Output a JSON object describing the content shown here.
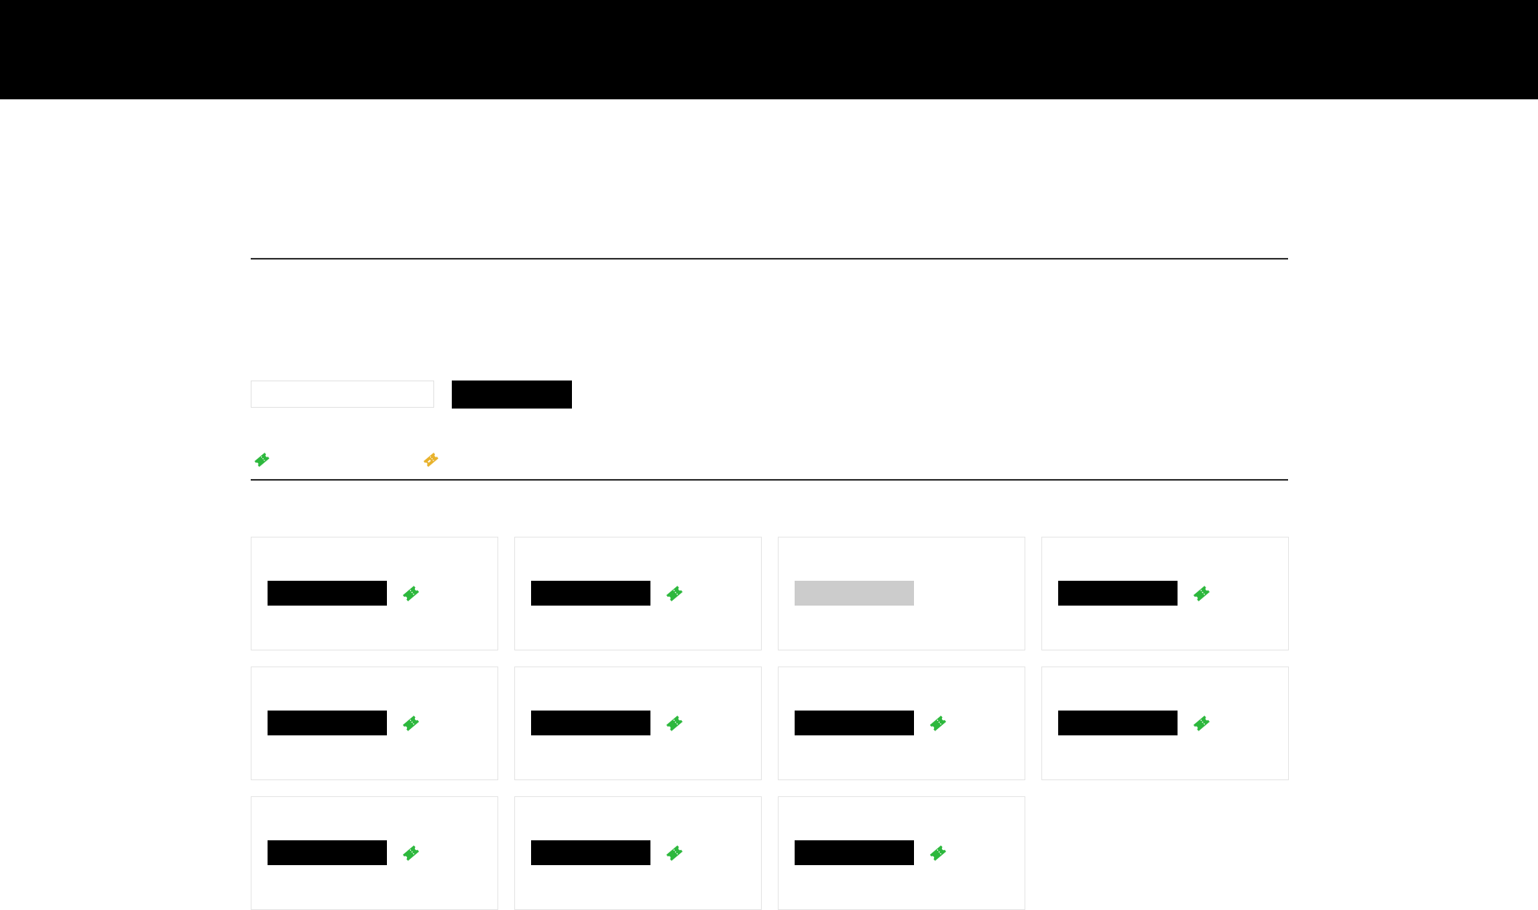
{
  "search": {
    "placeholder": "",
    "value": "",
    "button_label": ""
  },
  "legend": [
    {
      "label": "",
      "status": "available",
      "color": "#2db83d"
    },
    {
      "label": "",
      "status": "limited",
      "color": "#e8b22c"
    }
  ],
  "colors": {
    "header": "#000000",
    "available": "#2db83d",
    "limited": "#e8b22c",
    "unavailable_name": "#cccccc"
  },
  "items": [
    {
      "name": "",
      "status": "available",
      "icon": "ticket-icon"
    },
    {
      "name": "",
      "status": "available",
      "icon": "ticket-icon"
    },
    {
      "name": "",
      "status": "unavailable",
      "icon": null
    },
    {
      "name": "",
      "status": "available",
      "icon": "ticket-icon"
    },
    {
      "name": "",
      "status": "available",
      "icon": "ticket-icon"
    },
    {
      "name": "",
      "status": "available",
      "icon": "ticket-icon"
    },
    {
      "name": "",
      "status": "available",
      "icon": "ticket-icon"
    },
    {
      "name": "",
      "status": "available",
      "icon": "ticket-icon"
    },
    {
      "name": "",
      "status": "available",
      "icon": "ticket-icon"
    },
    {
      "name": "",
      "status": "available",
      "icon": "ticket-icon"
    },
    {
      "name": "",
      "status": "available",
      "icon": "ticket-icon"
    }
  ]
}
